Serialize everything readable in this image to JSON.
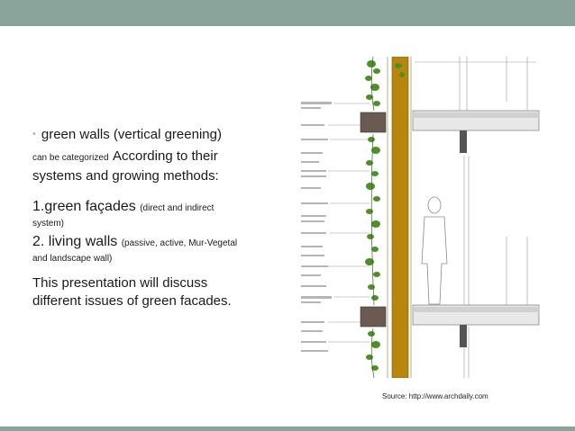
{
  "slide": {
    "bullet_glyph": "•",
    "bullet_main": "green walls (vertical greening)",
    "cat_small": "can be categorized",
    "cat_mid": "According to their",
    "cat_line2": "systems and growing methods:",
    "gf_label": "1.green façades",
    "gf_note": "(direct and indirect",
    "gf_note2": "system)",
    "lw_label": "2. living walls",
    "lw_note": "(passive, active, Mur-Vegetal",
    "lw_note2": "and landscape wall)",
    "closing_line1": "This presentation will discuss",
    "closing_line2": "different issues of green facades."
  },
  "image": {
    "source_caption": "Source: http://www.archdaily.com"
  },
  "colors": {
    "header_bar": "#8aa39b",
    "bullet": "#9cc2b6",
    "wall_wood": "#b8860b",
    "foliage": "#4f8f2a"
  }
}
